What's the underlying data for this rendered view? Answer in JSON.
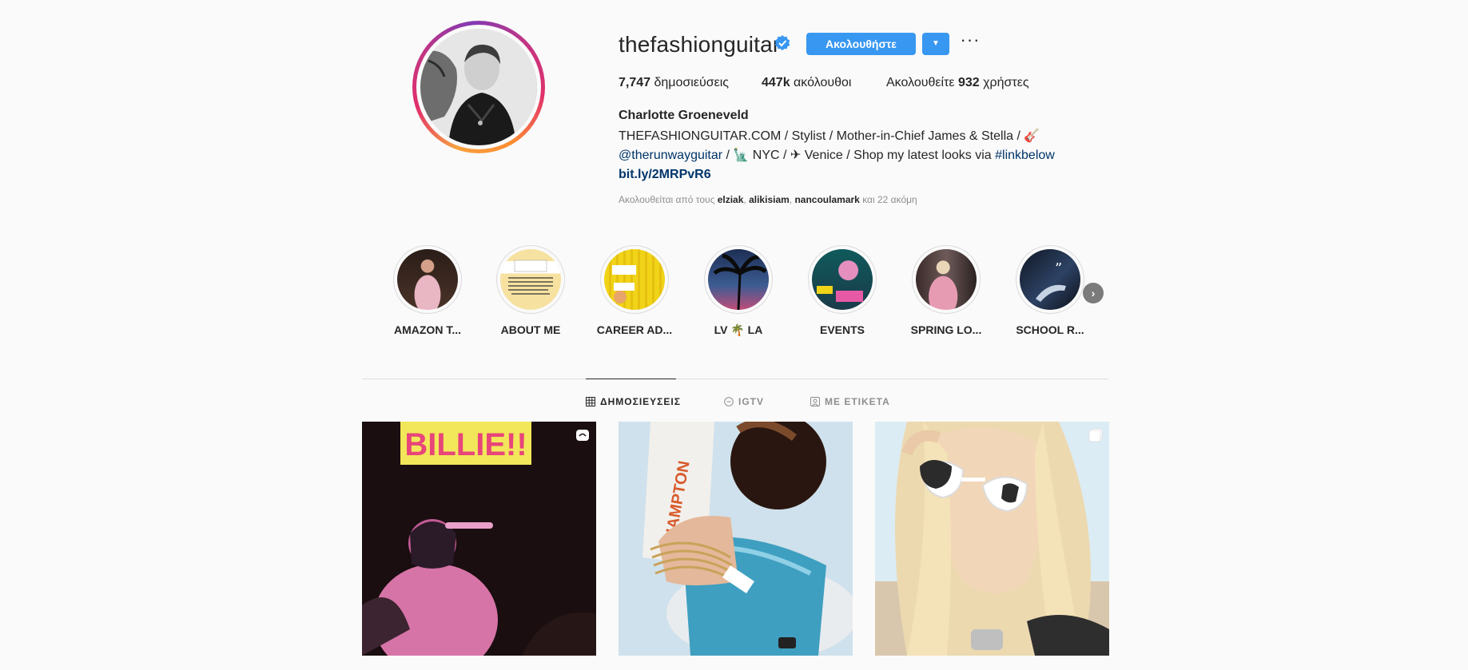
{
  "profile": {
    "username": "thefashionguitar",
    "follow_label": "Ακολουθήστε",
    "stats": {
      "posts_count": "7,747",
      "posts_label": "δημοσιεύσεις",
      "followers_count": "447k",
      "followers_label": "ακόλουθοι",
      "following_prefix": "Ακολουθείτε",
      "following_count": "932",
      "following_suffix": "χρήστες"
    },
    "full_name": "Charlotte Groeneveld",
    "bio": {
      "line1": "THEFASHIONGUITAR.COM / Stylist / Mother-in-Chief James & Stella / 🎸",
      "mention": "@therunwayguitar",
      "line2_mid": " / 🗽 NYC / ✈ Venice / Shop my latest looks via ",
      "hashtag": "#linkbelow",
      "link": "bit.ly/2MRPvR6"
    },
    "followed_by": {
      "prefix": "Ακολουθείται από τους",
      "user1": "elziak",
      "user2": "alikisiam",
      "user3": "nancoulamark",
      "suffix": "και 22 ακόμη"
    }
  },
  "highlights": [
    {
      "label": "AMAZON T..."
    },
    {
      "label": "ABOUT ME"
    },
    {
      "label": "CAREER AD..."
    },
    {
      "label": "LV 🌴 LA"
    },
    {
      "label": "EVENTS"
    },
    {
      "label": "SPRING LO..."
    },
    {
      "label": "SCHOOL R..."
    }
  ],
  "tabs": {
    "posts": "ΔΗΜΟΣΙΕΥΣΕΙΣ",
    "igtv": "IGTV",
    "tagged": "ΜΕ ΕΤΙΚΕΤΑ"
  },
  "posts": [
    {
      "caption_text": "BILLIE!!"
    },
    {
      "caption_text": "HAMPTON"
    },
    {
      "caption_text": ""
    }
  ],
  "colors": {
    "accent": "#3897f0",
    "link": "#003569",
    "border": "#dbdbdb",
    "muted": "#8e8e8e"
  }
}
